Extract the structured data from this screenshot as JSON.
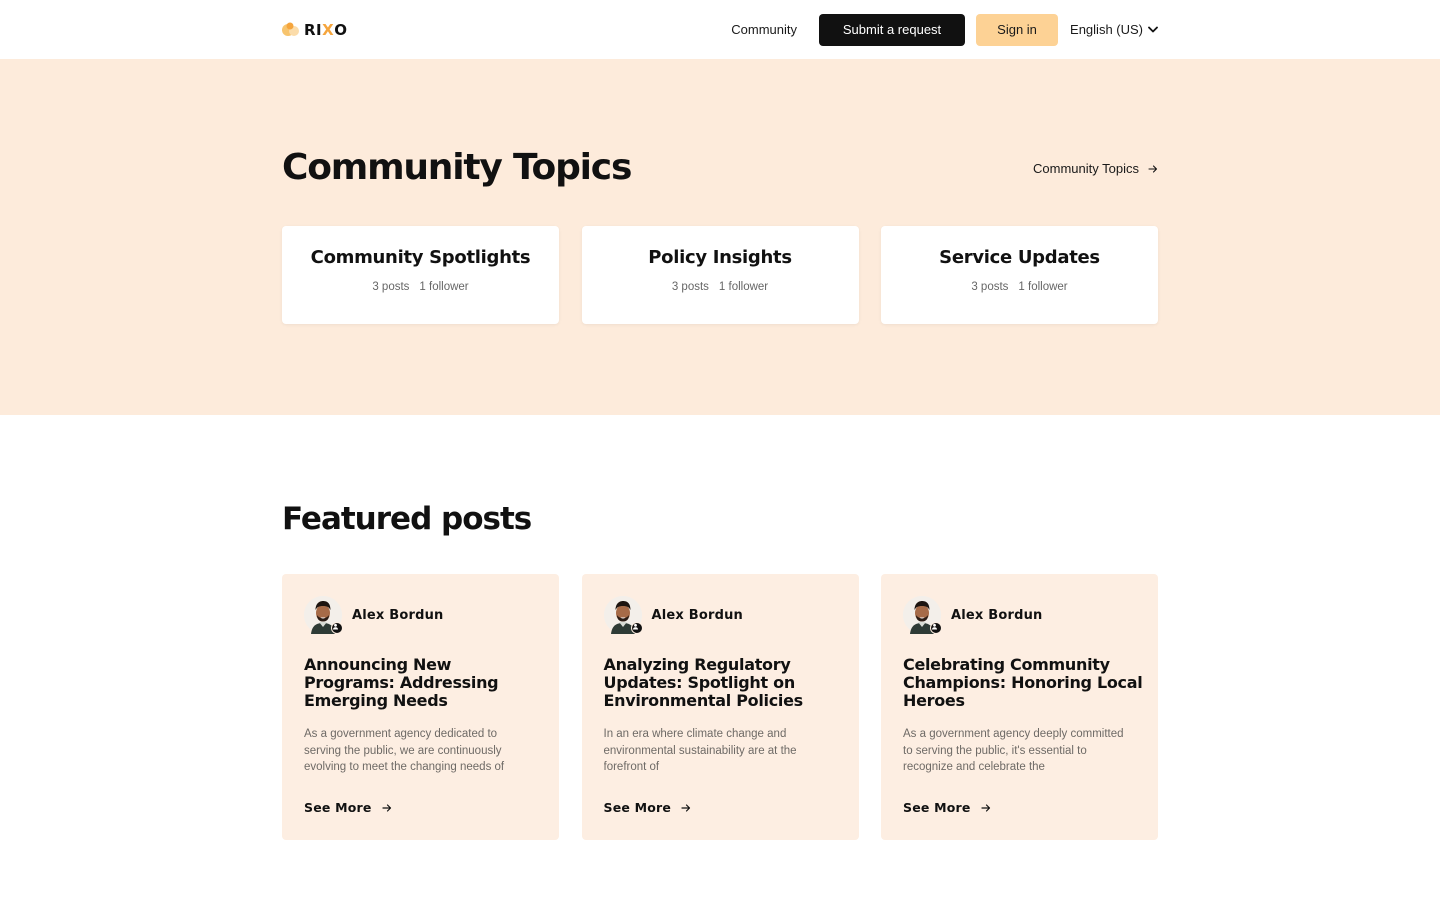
{
  "header": {
    "logo_text_a": "RI",
    "logo_text_x": "X",
    "logo_text_b": "O",
    "nav_community": "Community",
    "submit_request": "Submit a request",
    "sign_in": "Sign in",
    "language": "English (US)"
  },
  "topics": {
    "title": "Community Topics",
    "link_label": "Community Topics",
    "cards": [
      {
        "title": "Community Spotlights",
        "posts": "3 posts",
        "followers": "1 follower"
      },
      {
        "title": "Policy Insights",
        "posts": "3 posts",
        "followers": "1 follower"
      },
      {
        "title": "Service Updates",
        "posts": "3 posts",
        "followers": "1 follower"
      }
    ]
  },
  "featured": {
    "title": "Featured posts",
    "posts": [
      {
        "author": "Alex Bordun",
        "title": "Announcing New Programs: Addressing Emerging Needs",
        "excerpt": "As a government agency dedicated to serving the public, we are continuously evolving to meet the changing needs of",
        "cta": "See More"
      },
      {
        "author": "Alex Bordun",
        "title": "Analyzing Regulatory Updates: Spotlight on Environmental Policies",
        "excerpt": "In an era where climate change and environmental sustainability are at the forefront of",
        "cta": "See More"
      },
      {
        "author": "Alex Bordun",
        "title": "Celebrating Community Champions: Honoring Local Heroes",
        "excerpt": "As a government agency deeply committed to serving the public, it's essential to recognize and celebrate the",
        "cta": "See More"
      }
    ]
  },
  "colors": {
    "brand_accent": "#fdd295",
    "topics_bg": "#fdebdb",
    "post_card_bg": "#fdeee2",
    "primary_button": "#111111"
  }
}
